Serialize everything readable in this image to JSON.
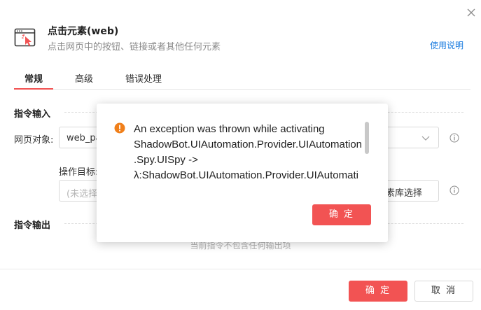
{
  "header": {
    "title": "点击元素(web)",
    "subtitle": "点击网页中的按钮、链接或者其他任何元素",
    "help_link": "使用说明",
    "icon": "pointer-click-window-icon"
  },
  "tabs": [
    {
      "label": "常规",
      "active": true
    },
    {
      "label": "高级",
      "active": false
    },
    {
      "label": "错误处理",
      "active": false
    }
  ],
  "sections": {
    "input_title": "指令输入",
    "output_title": "指令输出",
    "output_empty": "当前指令不包含任何输出项"
  },
  "fields": {
    "webpage_label": "网页对象:",
    "webpage_value": "web_pa",
    "target_label": "操作目标:",
    "target_placeholder": "(未选择)",
    "library_button": "元素库选择"
  },
  "footer": {
    "ok": "确 定",
    "cancel": "取 消"
  },
  "dialog": {
    "message_lines": [
      "An exception was thrown while activating",
      "ShadowBot.UIAutomation.Provider.UIAutomation",
      ".Spy.UISpy ->",
      "λ:ShadowBot.UIAutomation.Provider.UIAutomati"
    ],
    "ok": "确 定",
    "icon": "warning-circle-icon"
  },
  "colors": {
    "accent": "#f25353",
    "link": "#1d7ee0",
    "warning": "#f07f1a"
  }
}
